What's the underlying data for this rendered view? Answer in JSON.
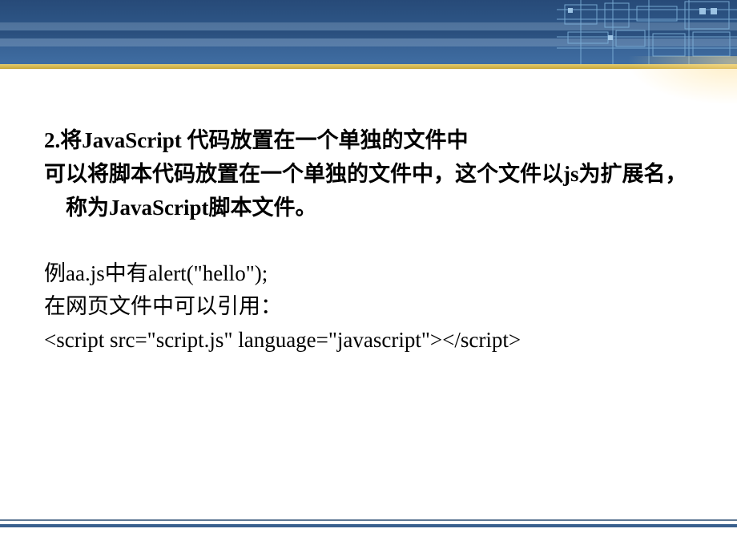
{
  "slide": {
    "heading": "2.将JavaScript 代码放置在一个单独的文件中",
    "intro": "可以将脚本代码放置在一个单独的文件中，这个文件以js为扩展名，称为JavaScript脚本文件。",
    "example_line1": "例aa.js中有alert(\"hello\");",
    "example_line2": "在网页文件中可以引用：",
    "code": "<script src=\"script.js\" language=\"javascript\"></script>"
  }
}
